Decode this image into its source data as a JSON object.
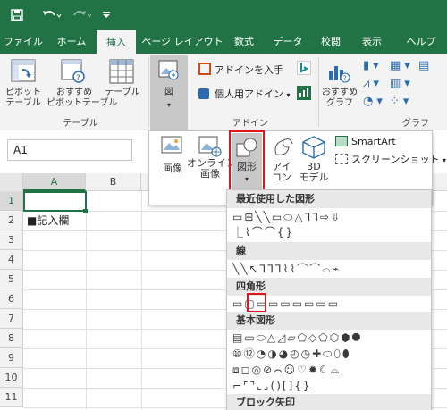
{
  "qat": {
    "save_icon": "save-icon",
    "undo_icon": "undo-icon",
    "redo_icon": "redo-icon",
    "customize_icon": "customize-qat-icon"
  },
  "tabs": [
    {
      "label": "ファイル"
    },
    {
      "label": "ホーム"
    },
    {
      "label": "挿入"
    },
    {
      "label": "ページ レイアウト"
    },
    {
      "label": "数式"
    },
    {
      "label": "データ"
    },
    {
      "label": "校閲"
    },
    {
      "label": "表示"
    },
    {
      "label": "ヘルプ"
    }
  ],
  "ribbon": {
    "pivot": "ピボット\nテーブル",
    "pivot_l1": "ピボット",
    "pivot_l2": "テーブル",
    "rec_pivot_l1": "おすすめ",
    "rec_pivot_l2": "ピボットテーブル",
    "table": "テーブル",
    "group_table": "テーブル",
    "illustrations": "図",
    "get_addins": "アドインを入手",
    "my_addins": "個人用アドイン",
    "group_addins": "アドイン",
    "rec_chart_l1": "おすすめ",
    "rec_chart_l2": "グラフ",
    "group_chart": "グラフ"
  },
  "formula": {
    "namebox": "A1"
  },
  "grid": {
    "columns": [
      "A",
      "B"
    ],
    "rows": [
      "1",
      "2",
      "3",
      "4",
      "5",
      "6",
      "7",
      "8",
      "9",
      "10",
      "11"
    ],
    "cell_a2": "■記入欄"
  },
  "dropdown": {
    "picture": "画像",
    "online_l1": "オンライン",
    "online_l2": "画像",
    "shapes": "図形",
    "icons_l1": "アイ",
    "icons_l2": "コン",
    "model_l1": "3D",
    "model_l2": "モデル",
    "smartart": "SmartArt",
    "screenshot": "スクリーンショット"
  },
  "shapes_panel": {
    "recent": "最近使用した図形",
    "lines": "線",
    "rectangles": "四角形",
    "basic": "基本図形",
    "arrows": "ブロック矢印",
    "recent_row1": "▭⊞╲╲▭⬭△⅂⅂⇨⇩",
    "recent_row2": "⎿⌇⌒⌒{}",
    "lines_row": "╲╲↖⅂⅂⅂⌇⌇⌒⌒⌓⌁",
    "rect_row": "▭▢▭▭▭▭▭▭▭",
    "basic_row1": "▤▭⬭△◿▱⬠◇⬠⬡⬢⯃",
    "basic_row2": "⑩⑫◔◑◕◴◷✚⬭⬯⬮",
    "basic_row3": "⧈◻◎⊘⌒☺♡✹☾⌓",
    "basic_row4": "⌐⌜⌝⌞⌟()[]{}"
  },
  "colors": {
    "excel_green": "#217346",
    "ribbon_bg": "#f3f3f3",
    "highlight": "#e0161f"
  }
}
